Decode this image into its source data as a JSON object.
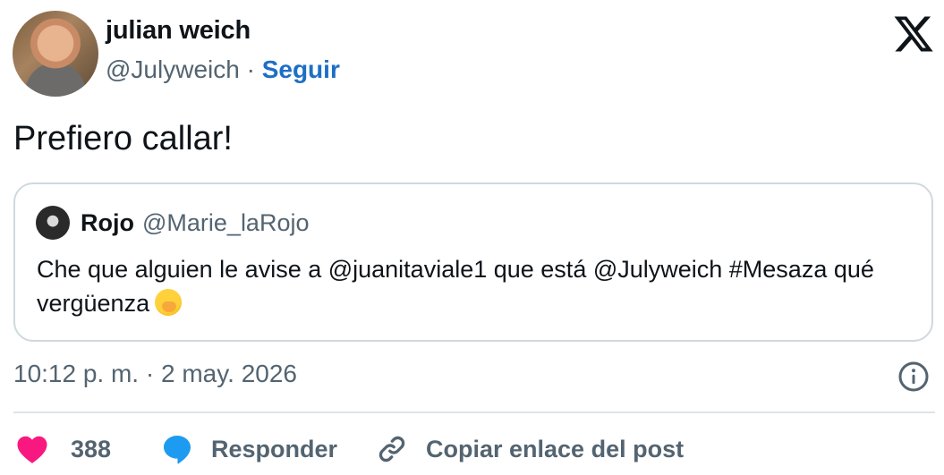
{
  "author": {
    "name": "julian weich",
    "handle": "@Julyweich",
    "separator": "·",
    "follow_label": "Seguir"
  },
  "tweet": {
    "text": "Prefiero callar!",
    "timestamp": "10:12 p. m. · 2 may. 2026"
  },
  "quote": {
    "name": "Rojo",
    "handle": "@Marie_laRojo",
    "text": "Che que alguien le avise a @juanitaviale1 que está @Julyweich #Mesaza qué vergüenza"
  },
  "actions": {
    "like_count": "388",
    "reply_label": "Responder",
    "copy_label": "Copiar enlace del post"
  },
  "icons": {
    "platform": "x-logo-icon",
    "like": "heart-icon",
    "reply": "speech-bubble-icon",
    "copy": "link-icon",
    "info": "info-icon"
  },
  "colors": {
    "like": "#f91880",
    "reply": "#1d9bf0",
    "follow": "#1d6fc4",
    "secondary_text": "#536471"
  }
}
